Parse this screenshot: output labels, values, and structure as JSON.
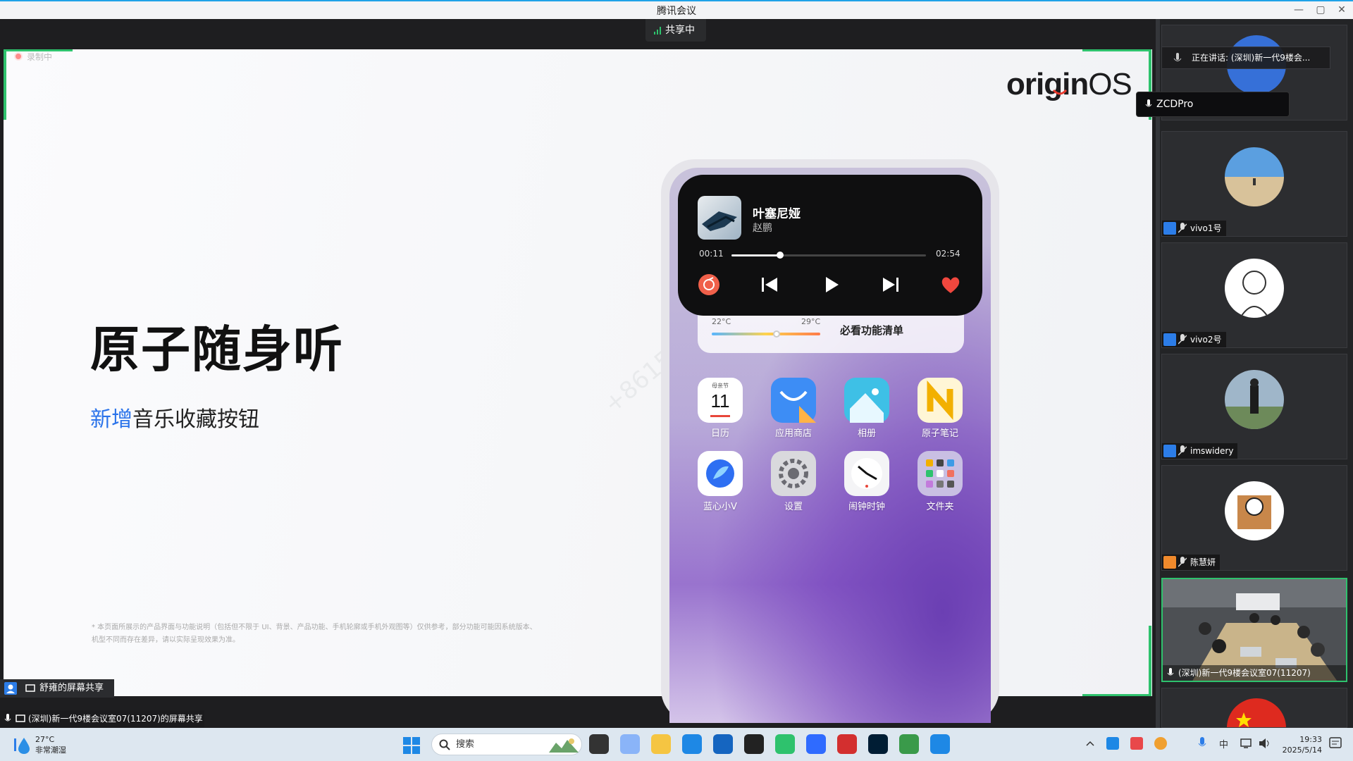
{
  "window": {
    "title": "腾讯会议"
  },
  "share": {
    "status": "共享中",
    "recording_label": "录制中",
    "sharer_chip": "舒雍的屏幕共享",
    "bottom_status": "(深圳)新一代9楼会议室07(11207)的屏幕共享"
  },
  "slide": {
    "brand_main": "origin",
    "brand_suffix": "OS",
    "headline": "原子随身听",
    "subline_highlight": "新增",
    "subline_rest": "音乐收藏按钮",
    "disclaimer": "* 本页面所展示的产品界面与功能说明（包括但不限于 UI、背景、产品功能、手机轮廓或手机外观图等）仅供参考，部分功能可能因系统版本、机型不同而存在差异，请以实际呈现效果为准。",
    "watermark": "+8615059012..."
  },
  "phone": {
    "song": "叶塞尼娅",
    "artist": "赵鹏",
    "time_current": "00:11",
    "time_total": "02:54",
    "progress": 0.25,
    "temp_low": "22°C",
    "temp_high": "29°C",
    "temp_marker": 0.6,
    "checklist": "必看功能清单",
    "apps": [
      {
        "label": "日历",
        "icon": "calendar-icon",
        "day": "11",
        "sub": "母亲节",
        "color": "#ffffff"
      },
      {
        "label": "应用商店",
        "icon": "app-store-icon",
        "color": "#3d8df5"
      },
      {
        "label": "相册",
        "icon": "gallery-icon",
        "color": "#3ec0e6"
      },
      {
        "label": "原子笔记",
        "icon": "notes-icon",
        "color": "#fff6d6"
      },
      {
        "label": "蓝心小V",
        "icon": "assistant-icon",
        "color": "#ffffff"
      },
      {
        "label": "设置",
        "icon": "settings-icon",
        "color": "#d9d9dd"
      },
      {
        "label": "闹钟时钟",
        "icon": "clock-icon",
        "color": "#f4f4f6"
      },
      {
        "label": "文件夹",
        "icon": "folder-icon",
        "color": "#c9bfe3"
      }
    ]
  },
  "panel": {
    "speaking": "正在讲话: (深圳)新一代9楼会...",
    "mic_user": "ZCDPro",
    "participants": [
      {
        "name": "vivo1号",
        "tag_color": "#2c7de8"
      },
      {
        "name": "vivo2号",
        "tag_color": "#2c7de8"
      },
      {
        "name": "imswidery",
        "tag_color": "#2c7de8"
      },
      {
        "name": "陈慧妍",
        "tag_color": "#f08a2c"
      }
    ],
    "room_name": "(深圳)新一代9楼会议室07(11207)"
  },
  "taskbar": {
    "search_placeholder": "搜索",
    "temperature": "27°C",
    "weather": "非常潮湿",
    "ime": "中",
    "time": "19:33",
    "date": "2025/5/14"
  }
}
